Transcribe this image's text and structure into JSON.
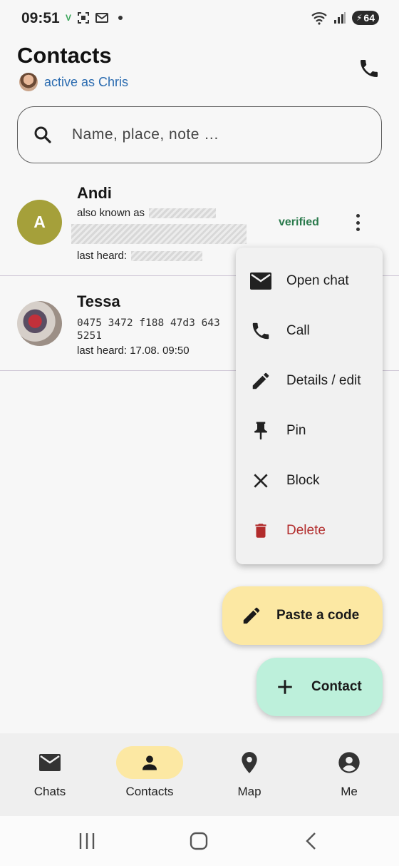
{
  "status_bar": {
    "time": "09:51",
    "battery": "64"
  },
  "header": {
    "title": "Contacts",
    "active_as": "active as Chris"
  },
  "search": {
    "placeholder": "Name, place, note …"
  },
  "contacts": [
    {
      "name": "Andi",
      "avatar_letter": "A",
      "also_known_as_label": "also known as",
      "last_heard_label": "last heard:",
      "status": "verified"
    },
    {
      "name": "Tessa",
      "code": "0475 3472 f188 47d3 643 5251",
      "last_heard": "last heard: 17.08. 09:50"
    }
  ],
  "context_menu": {
    "items": [
      {
        "label": "Open chat",
        "icon": "mail-icon"
      },
      {
        "label": "Call",
        "icon": "phone-icon"
      },
      {
        "label": "Details / edit",
        "icon": "edit-icon"
      },
      {
        "label": "Pin",
        "icon": "pin-icon"
      },
      {
        "label": "Block",
        "icon": "close-icon"
      },
      {
        "label": "Delete",
        "icon": "trash-icon"
      }
    ]
  },
  "fabs": {
    "paste_code": "Paste a code",
    "contact": "Contact"
  },
  "bottom_nav": {
    "items": [
      {
        "label": "Chats",
        "icon": "mail-icon"
      },
      {
        "label": "Contacts",
        "icon": "person-icon",
        "active": true
      },
      {
        "label": "Map",
        "icon": "location-pin-icon"
      },
      {
        "label": "Me",
        "icon": "account-circle-icon"
      }
    ]
  },
  "colors": {
    "accent_yellow": "#fce8a3",
    "accent_mint": "#bdf0db",
    "verified_green": "#2a7a4c",
    "danger_red": "#b22c2c",
    "link_blue": "#2a6bb0",
    "avatar_olive": "#a5a03a"
  }
}
